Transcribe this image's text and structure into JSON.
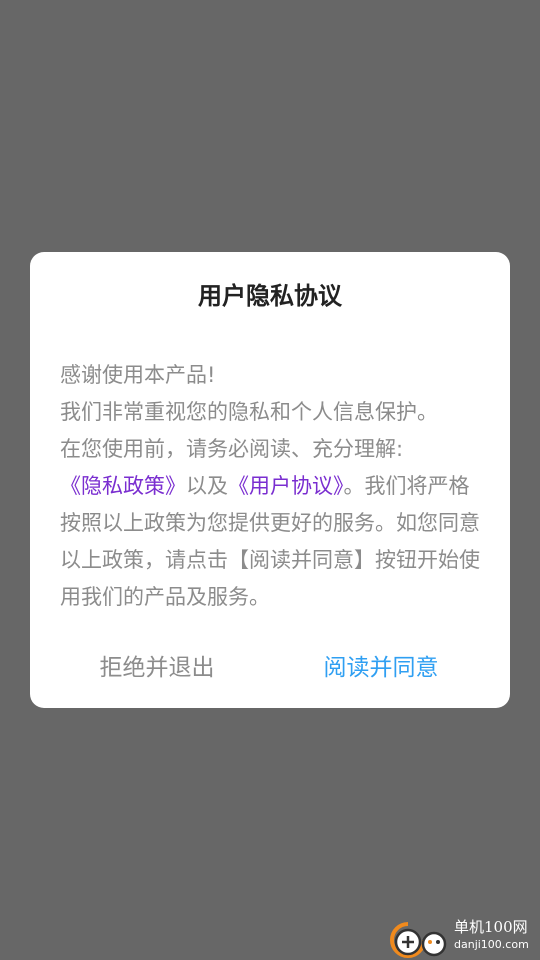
{
  "dialog": {
    "title": "用户隐私协议",
    "paragraphs": {
      "greeting": "感谢使用本产品!",
      "line1": "我们非常重视您的隐私和个人信息保护。",
      "line2": "在您使用前，请务必阅读、充分理解:",
      "privacy_link": "《隐私政策》",
      "and_text": "以及",
      "agreement_link": "《用户协议》",
      "rest": "。我们将严格按照以上政策为您提供更好的服务。如您同意以上政策，请点击【阅读并同意】按钮开始使用我们的产品及服务。"
    },
    "decline_label": "拒绝并退出",
    "accept_label": "阅读并同意"
  },
  "watermark": {
    "name": "单机100网",
    "url": "danji100.com"
  },
  "colors": {
    "overlay": "#676767",
    "link": "#7a2ed0",
    "accept": "#2f9ff2",
    "body_text": "#8c8c8c",
    "watermark_orange": "#f08a1d"
  }
}
